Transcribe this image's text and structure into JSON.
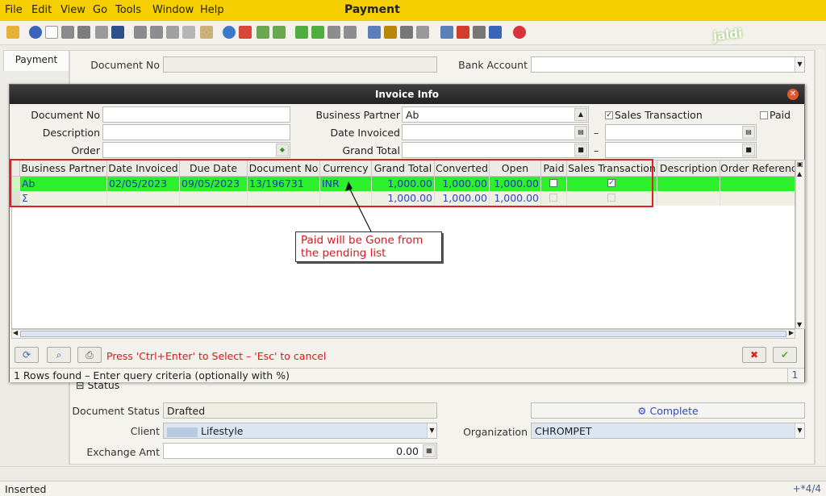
{
  "app": {
    "title": "Payment",
    "logo_text": "jaldi"
  },
  "menu": [
    {
      "label": "File",
      "key": "F"
    },
    {
      "label": "Edit",
      "key": "E"
    },
    {
      "label": "View",
      "key": "V"
    },
    {
      "label": "Go",
      "key": "G"
    },
    {
      "label": "Tools",
      "key": "T"
    },
    {
      "label": "Window",
      "key": ""
    },
    {
      "label": "Help",
      "key": "H"
    }
  ],
  "menu_labels": {
    "file": "File",
    "edit": "Edit",
    "view": "View",
    "go": "Go",
    "tools": "Tools",
    "window": "Window",
    "help": "Help"
  },
  "tabs": {
    "payment": "Payment"
  },
  "form": {
    "document_no_label": "Document No",
    "document_no_value": "",
    "bank_account_label": "Bank Account",
    "bank_account_value": "",
    "status_section": "Status",
    "document_status_label": "Document Status",
    "document_status_value": "Drafted",
    "complete_button": "Complete",
    "client_label": "Client",
    "client_value": "Lifestyle",
    "organization_label": "Organization",
    "organization_value": "CHROMPET",
    "exchange_amt_label": "Exchange Amt",
    "exchange_amt_value": "0.00"
  },
  "dialog": {
    "title": "Invoice Info",
    "document_no_label": "Document No",
    "document_no_value": "",
    "description_label": "Description",
    "description_value": "",
    "order_label": "Order",
    "order_value": "",
    "business_partner_label": "Business Partner",
    "business_partner_value": "Ab",
    "date_invoiced_label": "Date Invoiced",
    "date_invoiced_from": "",
    "date_invoiced_to": "",
    "grand_total_label": "Grand Total",
    "grand_total_from": "",
    "grand_total_to": "",
    "range_dash": "–",
    "sales_transaction_label": "Sales Transaction",
    "sales_transaction_checked": true,
    "paid_label": "Paid",
    "paid_checked": false,
    "grid": {
      "columns": [
        "Business Partner",
        "Date Invoiced",
        "Due Date",
        "Document No",
        "Currency",
        "Grand Total",
        "Converted",
        "Open",
        "Paid",
        "Sales Transaction",
        "Description",
        "Order Referenc"
      ],
      "rows": [
        {
          "business_partner": "Ab",
          "date_invoiced": "02/05/2023",
          "due_date": "09/05/2023",
          "document_no": "13/196731",
          "currency": "INR",
          "grand_total": "1,000.00",
          "converted": "1,000.00",
          "open": "1,000.00",
          "paid": false,
          "sales_transaction": true,
          "description": "",
          "order_reference": ""
        }
      ],
      "summary": {
        "symbol": "Σ",
        "grand_total": "1,000.00",
        "converted": "1,000.00",
        "open": "1,000.00"
      }
    },
    "callout": "Paid will be Gone from the pending list",
    "hint": "Press 'Ctrl+Enter' to Select – 'Esc' to cancel",
    "status": "1 Rows found – Enter query criteria (optionally with %)",
    "count": "1"
  },
  "statusbar": {
    "text": "Inserted",
    "right": "+*4/4"
  },
  "colors": {
    "menubar": "#f5cf00",
    "row_selected": "#2df02d",
    "accent_red": "#e0161d",
    "link_blue": "#3247c7"
  }
}
